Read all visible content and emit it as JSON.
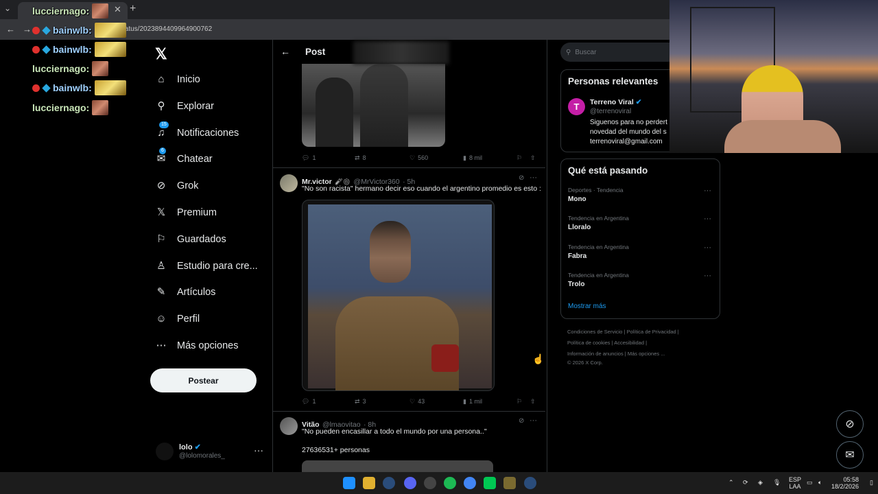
{
  "browser": {
    "url": "status/2023894409964900762"
  },
  "chat_overlay": [
    {
      "name": "lucciernago:",
      "badges": false
    },
    {
      "name": "bainwlb:",
      "badges": true
    },
    {
      "name": "bainwlb:",
      "badges": true
    },
    {
      "name": "lucciernago:",
      "badges": false
    },
    {
      "name": "bainwlb:",
      "badges": true
    },
    {
      "name": "lucciernago:",
      "badges": false
    }
  ],
  "nav": {
    "items": [
      {
        "label": "Inicio",
        "icon": "home-icon",
        "glyph": "⌂"
      },
      {
        "label": "Explorar",
        "icon": "search-icon",
        "glyph": "⚲"
      },
      {
        "label": "Notificaciones",
        "icon": "bell-icon",
        "glyph": "♫",
        "badge": "15"
      },
      {
        "label": "Chatear",
        "icon": "mail-icon",
        "glyph": "✉",
        "badge": "6"
      },
      {
        "label": "Grok",
        "icon": "grok-icon",
        "glyph": "⊘"
      },
      {
        "label": "Premium",
        "icon": "x-logo-icon",
        "glyph": "𝕏"
      },
      {
        "label": "Guardados",
        "icon": "bookmark-icon",
        "glyph": "⚐"
      },
      {
        "label": "Estudio para cre...",
        "icon": "flask-icon",
        "glyph": "♙"
      },
      {
        "label": "Artículos",
        "icon": "article-icon",
        "glyph": "✎"
      },
      {
        "label": "Perfil",
        "icon": "person-icon",
        "glyph": "☺"
      },
      {
        "label": "Más opciones",
        "icon": "more-circle-icon",
        "glyph": "⋯"
      }
    ],
    "post_button": "Postear",
    "profile": {
      "name": "lolo",
      "handle": "@lolomorales_"
    }
  },
  "header": {
    "title": "Post"
  },
  "posts": [
    {
      "replies": "1",
      "reposts": "8",
      "likes": "560",
      "views": "8 mil"
    },
    {
      "name": "Mr.victor",
      "handle": "@MrVictor360",
      "time": "· 5h",
      "text": "\"No son racista\" hermano decir eso cuando el argentino promedio es esto :",
      "replies": "1",
      "reposts": "3",
      "likes": "43",
      "views": "1 mil"
    },
    {
      "name": "Vitão",
      "handle": "@lmaovitao",
      "time": "· 8h",
      "text": "\"No pueden encasillar a todo el mundo por una persona..\"",
      "text2": "27636531+ personas"
    }
  ],
  "search": {
    "placeholder": "Buscar"
  },
  "relevant": {
    "title": "Personas relevantes",
    "name": "Terreno Viral",
    "handle": "@terrenoviral",
    "bio": [
      "Siguenos para no perdert",
      "novedad del mundo del s",
      "terrenoviral@gmail.com"
    ]
  },
  "trends": {
    "title": "Qué está pasando",
    "items": [
      {
        "category": "Deportes · Tendencia",
        "name": "Mono"
      },
      {
        "category": "Tendencia en Argentina",
        "name": "Lloralo"
      },
      {
        "category": "Tendencia en Argentina",
        "name": "Fabra"
      },
      {
        "category": "Tendencia en Argentina",
        "name": "Trolo"
      }
    ],
    "show_more": "Mostrar más"
  },
  "footer": {
    "line1": [
      "Condiciones de Servicio",
      "Política de Privacidad"
    ],
    "line2": [
      "Política de cookies",
      "Accesibilidad"
    ],
    "line3": [
      "Información de anuncios",
      "Más opciones ..."
    ],
    "line4": "© 2026 X Corp."
  },
  "taskbar": {
    "lang": "ESP",
    "lang2": "LAA",
    "time": "05:58",
    "date": "18/2/2026"
  },
  "colors": {
    "accent": "#1d9bf0",
    "background": "#000000"
  }
}
